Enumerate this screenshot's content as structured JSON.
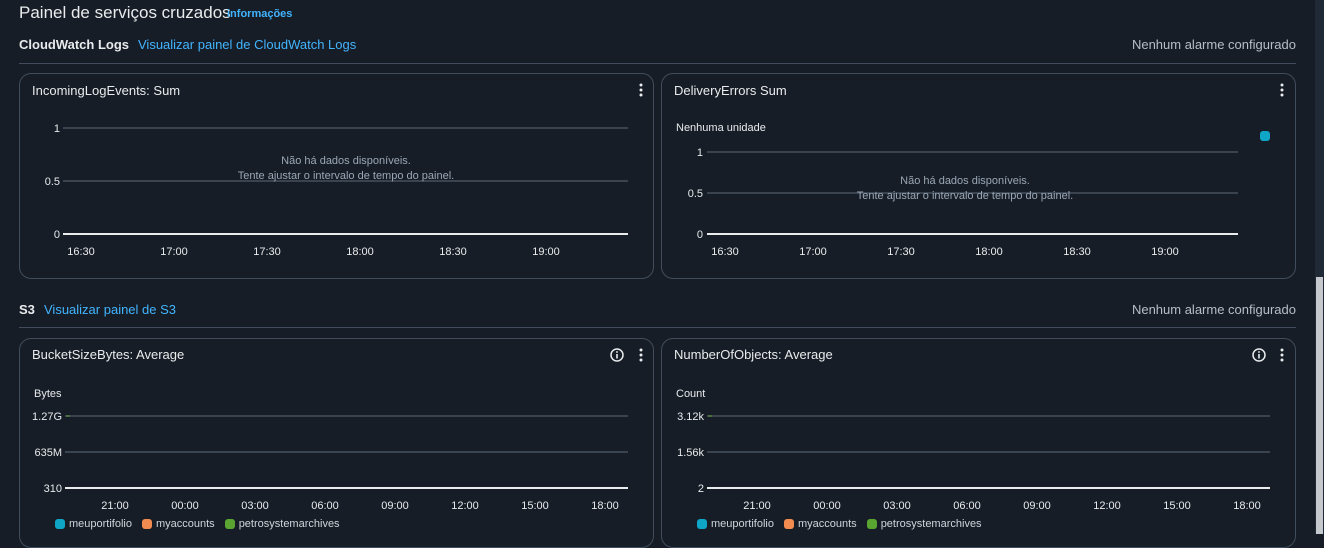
{
  "dashboard": {
    "title": "Painel de serviços cruzados",
    "info_link": "informações"
  },
  "colors": {
    "background": "#161d26",
    "border": "#414d5c",
    "link": "#42b4ff",
    "legend_blue": "#0ea5c6",
    "legend_orange": "#f28b50",
    "legend_green": "#5aa531"
  },
  "sections": [
    {
      "name": "CloudWatch Logs",
      "link": "Visualizar painel de CloudWatch Logs",
      "status": "Nenhum alarme configurado"
    },
    {
      "name": "S3",
      "link": "Visualizar painel de S3",
      "status": "Nenhum alarme configurado"
    }
  ],
  "widgets": {
    "incoming": {
      "title": "IncomingLogEvents: Sum",
      "menu_icon": "more-vertical-icon",
      "no_data_line1": "Não há dados disponíveis.",
      "no_data_line2": "Tente ajustar o intervalo de tempo do painel.",
      "yticks": [
        "1",
        "0.5",
        "0"
      ],
      "xticks": [
        "16:30",
        "17:00",
        "17:30",
        "18:00",
        "18:30",
        "19:00"
      ]
    },
    "delivery": {
      "title": "DeliveryErrors Sum",
      "menu_icon": "more-vertical-icon",
      "unit_label": "Nenhuma unidade",
      "no_data_line1": "Não há dados disponíveis.",
      "no_data_line2": "Tente ajustar o intervalo de tempo do painel.",
      "yticks": [
        "1",
        "0.5",
        "0"
      ],
      "xticks": [
        "16:30",
        "17:00",
        "17:30",
        "18:00",
        "18:30",
        "19:00"
      ],
      "legend_swatch_color": "#0ea5c6"
    },
    "bucket": {
      "title": "BucketSizeBytes: Average",
      "info_icon": "info-icon",
      "menu_icon": "more-vertical-icon",
      "unit_label": "Bytes",
      "yticks": [
        "1.27G",
        "635M",
        "310"
      ],
      "xticks": [
        "21:00",
        "00:00",
        "03:00",
        "06:00",
        "09:00",
        "12:00",
        "15:00",
        "18:00"
      ],
      "legend": [
        "meuportifolio",
        "myaccounts",
        "petrosystemarchives"
      ]
    },
    "objects": {
      "title": "NumberOfObjects: Average",
      "info_icon": "info-icon",
      "menu_icon": "more-vertical-icon",
      "unit_label": "Count",
      "yticks": [
        "3.12k",
        "1.56k",
        "2"
      ],
      "xticks": [
        "21:00",
        "00:00",
        "03:00",
        "06:00",
        "09:00",
        "12:00",
        "15:00",
        "18:00"
      ],
      "legend": [
        "meuportifolio",
        "myaccounts",
        "petrosystemarchives"
      ]
    }
  }
}
